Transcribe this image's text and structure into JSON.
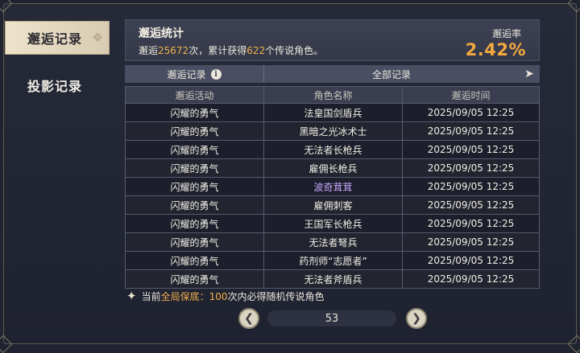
{
  "sidebar": {
    "tabs": [
      {
        "label": "邂逅记录",
        "active": true
      },
      {
        "label": "投影记录",
        "active": false
      }
    ]
  },
  "stats": {
    "title": "邂逅统计",
    "line_prefix": "邂逅",
    "count": "25672",
    "line_mid": "次，累计获得",
    "legendary": "622",
    "line_suffix": "个传说角色。",
    "rate_label": "邂逅率",
    "rate_value": "2.42%"
  },
  "filter": {
    "label": "邂逅记录",
    "value": "全部记录"
  },
  "table": {
    "headers": [
      "邂逅活动",
      "角色名称",
      "邂逅时间"
    ],
    "rows": [
      {
        "activity": "闪耀的勇气",
        "name": "法皇国剑盾兵",
        "time": "2025/09/05 12:25"
      },
      {
        "activity": "闪耀的勇气",
        "name": "黑暗之光冰术士",
        "time": "2025/09/05 12:25"
      },
      {
        "activity": "闪耀的勇气",
        "name": "无法者长枪兵",
        "time": "2025/09/05 12:25"
      },
      {
        "activity": "闪耀的勇气",
        "name": "雇佣长枪兵",
        "time": "2025/09/05 12:25"
      },
      {
        "activity": "闪耀的勇气",
        "name": "波奇茸茸",
        "time": "2025/09/05 12:25"
      },
      {
        "activity": "闪耀的勇气",
        "name": "雇佣刺客",
        "time": "2025/09/05 12:25"
      },
      {
        "activity": "闪耀的勇气",
        "name": "王国军长枪兵",
        "time": "2025/09/05 12:25"
      },
      {
        "activity": "闪耀的勇气",
        "name": "无法者弩兵",
        "time": "2025/09/05 12:25"
      },
      {
        "activity": "闪耀的勇气",
        "name": "药剂师“志愿者”",
        "time": "2025/09/05 12:25"
      },
      {
        "activity": "闪耀的勇气",
        "name": "无法者斧盾兵",
        "time": "2025/09/05 12:25"
      }
    ]
  },
  "pity": {
    "prefix": "当前",
    "highlight": "全局保底：",
    "count": "100",
    "suffix": "次内必得随机传说角色"
  },
  "pager": {
    "page": "53"
  },
  "colors": {
    "accent": "#f2a93e",
    "rare_name": "#c8a8ff"
  }
}
